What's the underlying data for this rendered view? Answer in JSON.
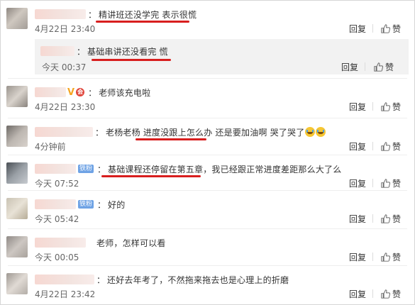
{
  "actions": {
    "reply": "回复",
    "like": "赞"
  },
  "comments": [
    {
      "text": "精讲班还没学完  表示很慌",
      "time": "4月22日 23:40"
    },
    {
      "text": "基础串讲还没看完 慌",
      "time": "今天 00:37"
    },
    {
      "text": "老师该充电啦",
      "time": "4月22日 23:30"
    },
    {
      "text": "老杨老杨 进度没跟上怎么办 还是要加油啊 哭了哭了",
      "time": "4分钟前"
    },
    {
      "badge": "铁粉",
      "text": "基础课程还停留在第五章，我已经跟正常进度差距那么大了么",
      "time": "今天 07:52"
    },
    {
      "badge": "铁粉",
      "text": "好的",
      "time": "今天 05:42"
    },
    {
      "text": "老师，怎样可以看",
      "time": "今天 00:05"
    },
    {
      "text": "还好去年考了，不然拖来拖去也是心理上的折磨",
      "time": "4月22日 23:42"
    }
  ],
  "colors": {
    "underline": "#d81e1e",
    "badge": "#6fa3e5",
    "vip": "#f5a623"
  }
}
